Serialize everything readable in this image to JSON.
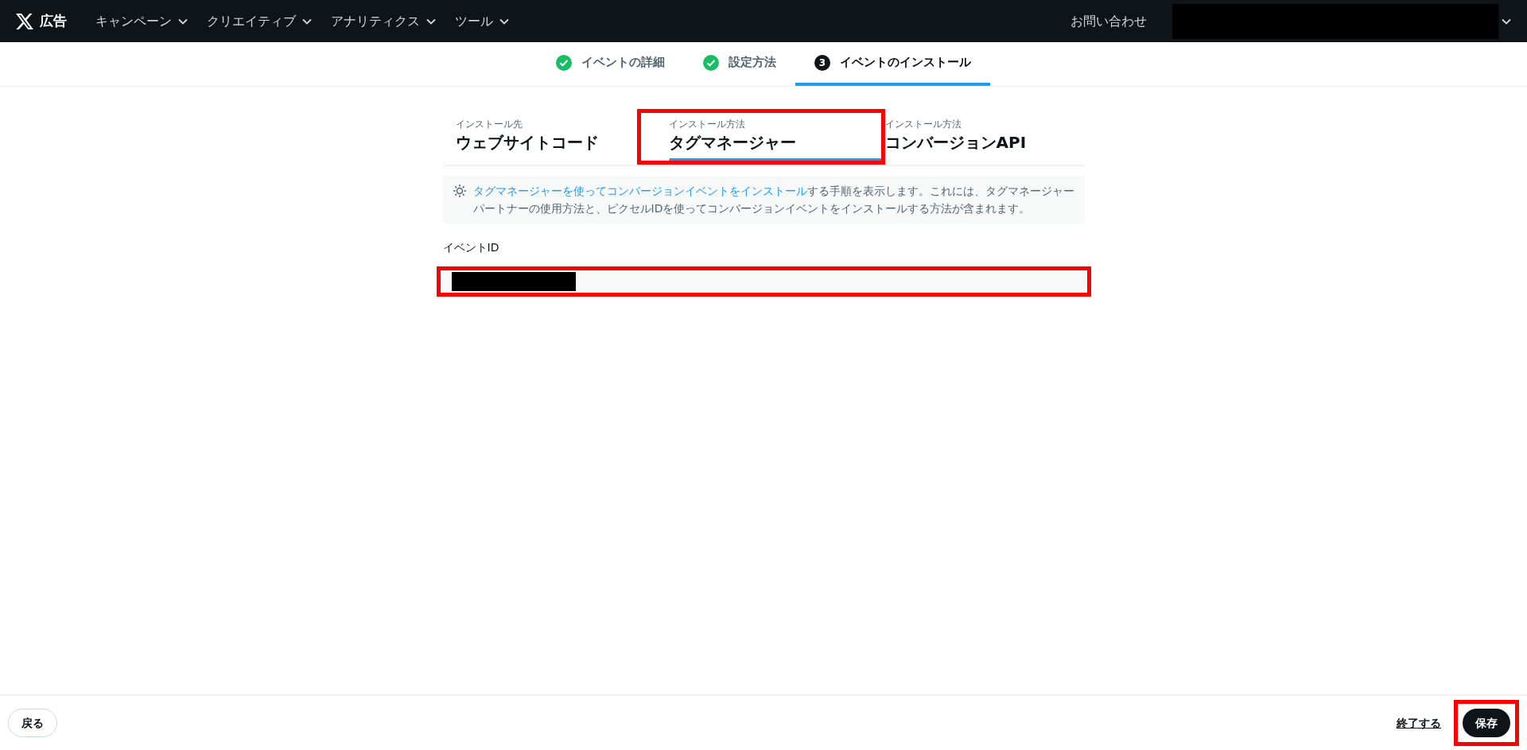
{
  "nav": {
    "brand": "広告",
    "menus": [
      {
        "label": "キャンペーン"
      },
      {
        "label": "クリエイティブ"
      },
      {
        "label": "アナリティクス"
      },
      {
        "label": "ツール"
      }
    ],
    "contact": "お問い合わせ",
    "account_redacted": true
  },
  "steps": [
    {
      "label": "イベントの詳細",
      "kind": "done",
      "selected": false
    },
    {
      "label": "設定方法",
      "kind": "done",
      "selected": false
    },
    {
      "label": "イベントのインストール",
      "kind": "current",
      "number": "3",
      "selected": true
    }
  ],
  "tabs": [
    {
      "caption": "インストール先",
      "title": "ウェブサイトコード",
      "selected": false,
      "highlighted": false
    },
    {
      "caption": "インストール方法",
      "title": "タグマネージャー",
      "selected": true,
      "highlighted": true
    },
    {
      "caption": "インストール方法",
      "title": "コンバージョンAPI",
      "selected": false,
      "highlighted": false
    }
  ],
  "info": {
    "link": "タグマネージャーを使ってコンバージョンイベントをインストール",
    "text": "する手順を表示します。これには、タグマネージャーパートナーの使用方法と、ピクセルIDを使ってコンバージョンイベントをインストールする方法が含まれます。"
  },
  "event_id": {
    "label": "イベントID",
    "value_redacted": true,
    "highlighted": true
  },
  "footer": {
    "back": "戻る",
    "finish": "終了する",
    "save": "保存",
    "save_highlighted": true
  }
}
